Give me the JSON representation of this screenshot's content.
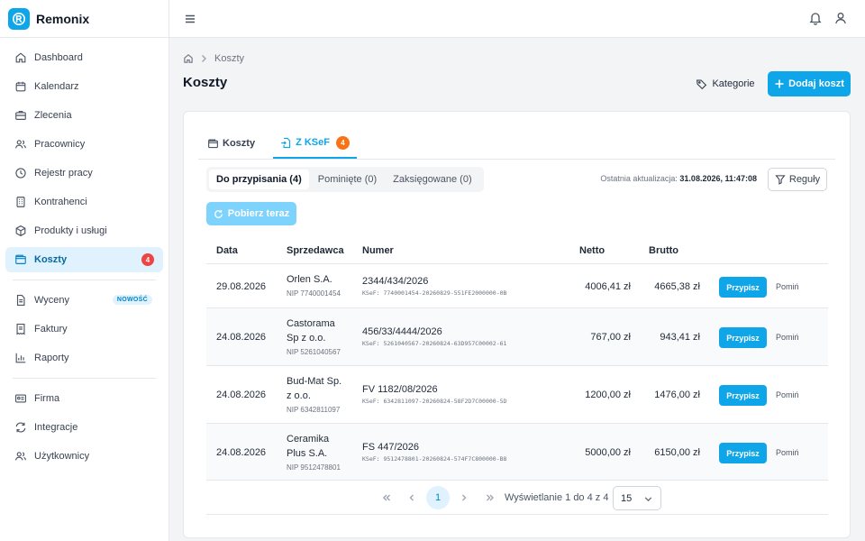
{
  "app": {
    "name": "Remonix"
  },
  "sidebar": {
    "items": [
      {
        "label": "Dashboard",
        "icon": "home-icon"
      },
      {
        "label": "Kalendarz",
        "icon": "calendar-icon"
      },
      {
        "label": "Zlecenia",
        "icon": "briefcase-icon"
      },
      {
        "label": "Pracownicy",
        "icon": "users-icon"
      },
      {
        "label": "Rejestr pracy",
        "icon": "clock-icon"
      },
      {
        "label": "Kontrahenci",
        "icon": "building-icon"
      },
      {
        "label": "Produkty i usługi",
        "icon": "package-icon"
      },
      {
        "label": "Koszty",
        "icon": "wallet-icon",
        "badge": "4",
        "active": true
      },
      {
        "label": "Wyceny",
        "icon": "document-icon",
        "tag": "NOWOŚĆ"
      },
      {
        "label": "Faktury",
        "icon": "receipt-icon"
      },
      {
        "label": "Raporty",
        "icon": "chart-icon"
      },
      {
        "label": "Firma",
        "icon": "id-card-icon"
      },
      {
        "label": "Integracje",
        "icon": "refresh-icon"
      },
      {
        "label": "Użytkownicy",
        "icon": "users-cog-icon"
      }
    ]
  },
  "breadcrumb": {
    "current": "Koszty"
  },
  "page": {
    "title": "Koszty"
  },
  "actions": {
    "categories": "Kategorie",
    "add": "Dodaj koszt"
  },
  "tabs": [
    {
      "label": "Koszty"
    },
    {
      "label": "Z KSeF",
      "badge": "4"
    }
  ],
  "filters": [
    {
      "label": "Do przypisania (4)"
    },
    {
      "label": "Pominięte (0)"
    },
    {
      "label": "Zaksięgowane (0)"
    }
  ],
  "update": {
    "label": "Ostatnia aktualizacja:",
    "value": "31.08.2026, 11:47:08"
  },
  "rules": "Reguły",
  "fetch": "Pobierz teraz",
  "table": {
    "columns": {
      "date": "Data",
      "seller": "Sprzedawca",
      "number": "Numer",
      "netto": "Netto",
      "brutto": "Brutto"
    },
    "rows": [
      {
        "date": "29.08.2026",
        "seller": "Orlen S.A.",
        "nip": "NIP 7740001454",
        "number": "2344/434/2026",
        "ksef": "KSeF: 7740001454-20260829-551FE2000000-0B",
        "netto": "4006,41 zł",
        "brutto": "4665,38 zł"
      },
      {
        "date": "24.08.2026",
        "seller": "Castorama Sp z o.o.",
        "nip": "NIP 5261040567",
        "number": "456/33/4444/2026",
        "ksef": "KSeF: 5261040567-20260824-63D957C00002-61",
        "netto": "767,00 zł",
        "brutto": "943,41 zł"
      },
      {
        "date": "24.08.2026",
        "seller": "Bud-Mat Sp. z o.o.",
        "nip": "NIP 6342811097",
        "number": "FV 1182/08/2026",
        "ksef": "KSeF: 6342811097-20260824-58F2D7C00000-5D",
        "netto": "1200,00 zł",
        "brutto": "1476,00 zł"
      },
      {
        "date": "24.08.2026",
        "seller": "Ceramika Plus S.A.",
        "nip": "NIP 9512478801",
        "number": "FS 447/2026",
        "ksef": "KSeF: 9512478801-20260824-574F7C800000-B8",
        "netto": "5000,00 zł",
        "brutto": "6150,00 zł"
      }
    ],
    "assign": "Przypisz",
    "skip": "Pomiń"
  },
  "pagination": {
    "page": "1",
    "info": "Wyświetlanie 1 do 4 z 4",
    "per_page": "15"
  }
}
